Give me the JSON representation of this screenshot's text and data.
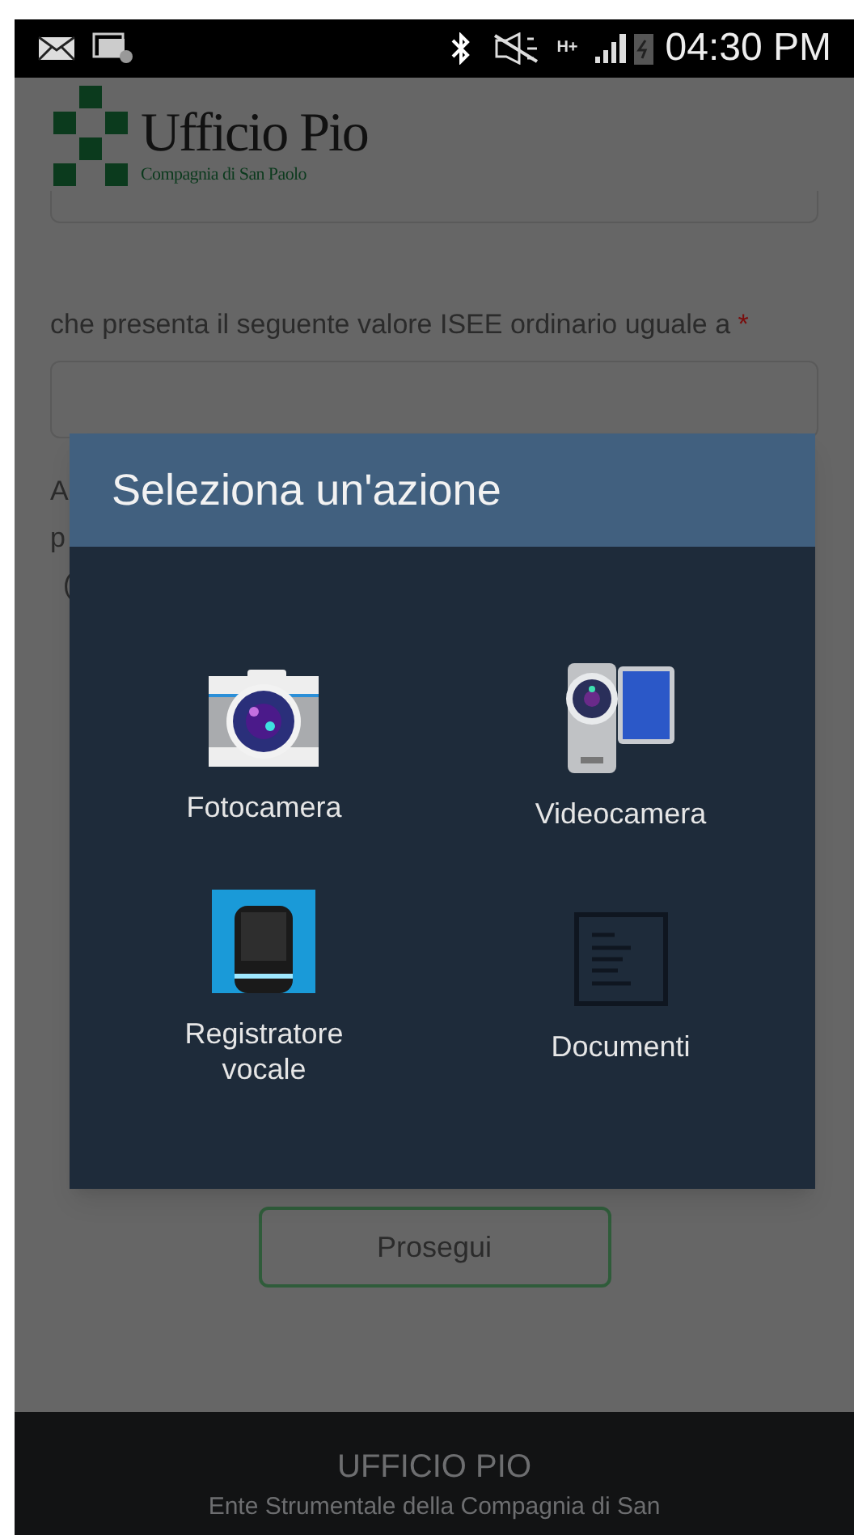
{
  "status_bar": {
    "network": "H+",
    "time": "04:30 PM"
  },
  "header": {
    "logo_title": "Ufficio Pio",
    "logo_subtitle": "Compagnia di San Paolo"
  },
  "form": {
    "label": "che presenta il seguente valore ISEE ordinario uguale a",
    "required_mark": "*",
    "occluded_fragments": [
      "A",
      "p",
      "("
    ],
    "submit": "Prosegui"
  },
  "dialog": {
    "title": "Seleziona un'azione",
    "actions": [
      {
        "label": "Fotocamera",
        "kind": "camera"
      },
      {
        "label": "Videocamera",
        "kind": "video"
      },
      {
        "label": "Registratore vocale",
        "kind": "recorder"
      },
      {
        "label": "Documenti",
        "kind": "documents"
      }
    ]
  },
  "footer": {
    "title": "UFFICIO PIO",
    "subtitle": "Ente Strumentale della Compagnia di San"
  }
}
